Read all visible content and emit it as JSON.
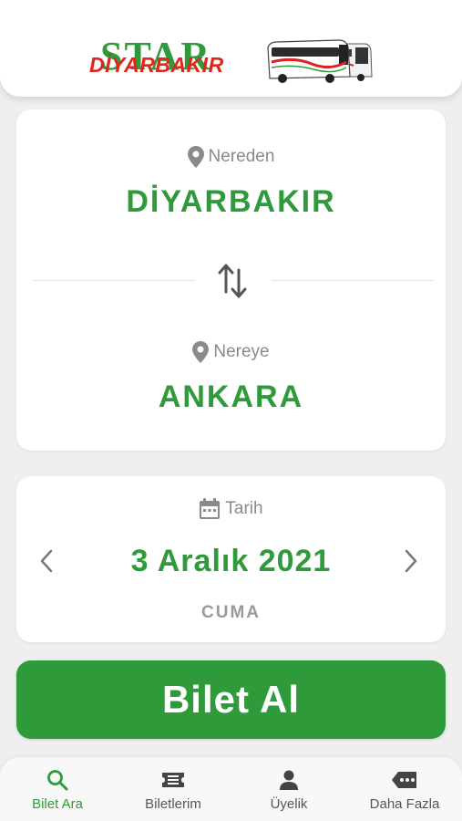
{
  "header": {
    "logo_top": "STAR",
    "logo_city": "DİYARBAKIR"
  },
  "route": {
    "from_label": "Nereden",
    "from_city": "DİYARBAKIR",
    "to_label": "Nereye",
    "to_city": "ANKARA"
  },
  "date": {
    "label": "Tarih",
    "value": "3 Aralık 2021",
    "day": "CUMA"
  },
  "buy_button": "Bilet Al",
  "tabs": [
    {
      "label": "Bilet Ara",
      "icon": "search-icon",
      "active": true
    },
    {
      "label": "Biletlerim",
      "icon": "ticket-icon",
      "active": false
    },
    {
      "label": "Üyelik",
      "icon": "person-icon",
      "active": false
    },
    {
      "label": "Daha Fazla",
      "icon": "more-icon",
      "active": false
    }
  ],
  "colors": {
    "primary_green": "#2e9a3a",
    "logo_red": "#e0261c",
    "muted_gray": "#8a8a8a",
    "background": "#efefef"
  }
}
